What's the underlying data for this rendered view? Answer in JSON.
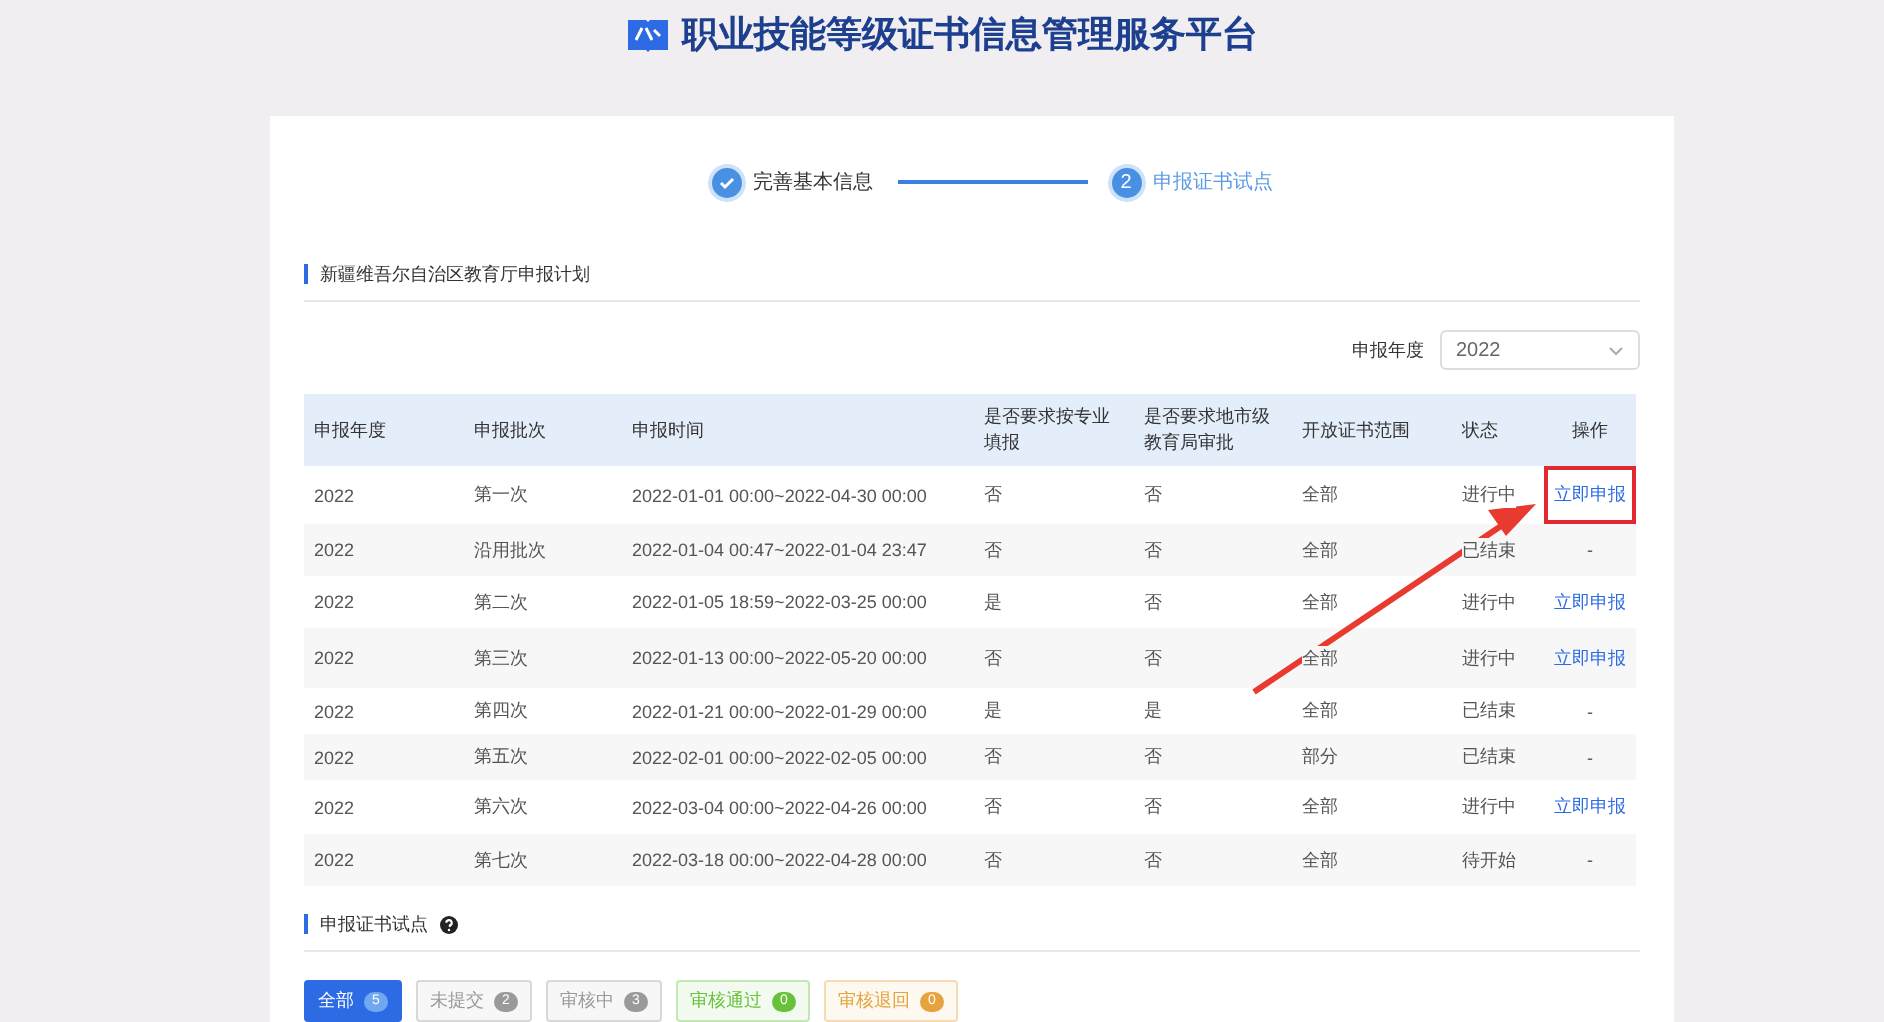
{
  "header": {
    "title": "职业技能等级证书信息管理服务平台"
  },
  "steps": [
    {
      "label": "完善基本信息",
      "kind": "done"
    },
    {
      "label": "申报证书试点",
      "kind": "current",
      "number": "2"
    }
  ],
  "plan": {
    "section_title": "新疆维吾尔自治区教育厅申报计划",
    "year_filter": {
      "label": "申报年度",
      "value": "2022"
    },
    "columns": [
      "申报年度",
      "申报批次",
      "申报时间",
      "是否要求按专业填报",
      "是否要求地市级教育局审批",
      "开放证书范围",
      "状态",
      "操作"
    ],
    "rows": [
      {
        "cells": [
          "2022",
          "第一次",
          "2022-01-01 00:00~2022-04-30 00:00",
          "否",
          "否",
          "全部",
          "进行中"
        ],
        "action": {
          "kind": "link",
          "label": "立即申报",
          "highlighted": true
        }
      },
      {
        "cells": [
          "2022",
          "沿用批次",
          "2022-01-04 00:47~2022-01-04 23:47",
          "否",
          "否",
          "全部",
          "已结束"
        ],
        "action": {
          "kind": "text",
          "label": "-",
          "highlighted": false
        }
      },
      {
        "cells": [
          "2022",
          "第二次",
          "2022-01-05 18:59~2022-03-25 00:00",
          "是",
          "否",
          "全部",
          "进行中"
        ],
        "action": {
          "kind": "link",
          "label": "立即申报",
          "highlighted": false
        }
      },
      {
        "cells": [
          "2022",
          "第三次",
          "2022-01-13 00:00~2022-05-20 00:00",
          "否",
          "否",
          "全部",
          "进行中"
        ],
        "action": {
          "kind": "link",
          "label": "立即申报",
          "highlighted": false
        }
      },
      {
        "cells": [
          "2022",
          "第四次",
          "2022-01-21 00:00~2022-01-29 00:00",
          "是",
          "是",
          "全部",
          "已结束"
        ],
        "action": {
          "kind": "text",
          "label": "-",
          "highlighted": false
        }
      },
      {
        "cells": [
          "2022",
          "第五次",
          "2022-02-01 00:00~2022-02-05 00:00",
          "否",
          "否",
          "部分",
          "已结束"
        ],
        "action": {
          "kind": "text",
          "label": "-",
          "highlighted": false
        }
      },
      {
        "cells": [
          "2022",
          "第六次",
          "2022-03-04 00:00~2022-04-26 00:00",
          "否",
          "否",
          "全部",
          "进行中"
        ],
        "action": {
          "kind": "link",
          "label": "立即申报",
          "highlighted": false
        }
      },
      {
        "cells": [
          "2022",
          "第七次",
          "2022-03-18 00:00~2022-04-28 00:00",
          "否",
          "否",
          "全部",
          "待开始"
        ],
        "action": {
          "kind": "text",
          "label": "-",
          "highlighted": false
        }
      }
    ]
  },
  "pilot": {
    "section_title": "申报证书试点",
    "filters": [
      {
        "label": "全部",
        "count": "5",
        "selected": true,
        "color": "#2d6be4"
      },
      {
        "label": "未提交",
        "count": "2",
        "selected": false,
        "color": "#9a9a9a"
      },
      {
        "label": "审核中",
        "count": "3",
        "selected": false,
        "color": "#9a9a9a"
      },
      {
        "label": "审核通过",
        "count": "0",
        "selected": false,
        "color": "#67c23a"
      },
      {
        "label": "审核退回",
        "count": "0",
        "selected": false,
        "color": "#e6a23c"
      }
    ]
  }
}
